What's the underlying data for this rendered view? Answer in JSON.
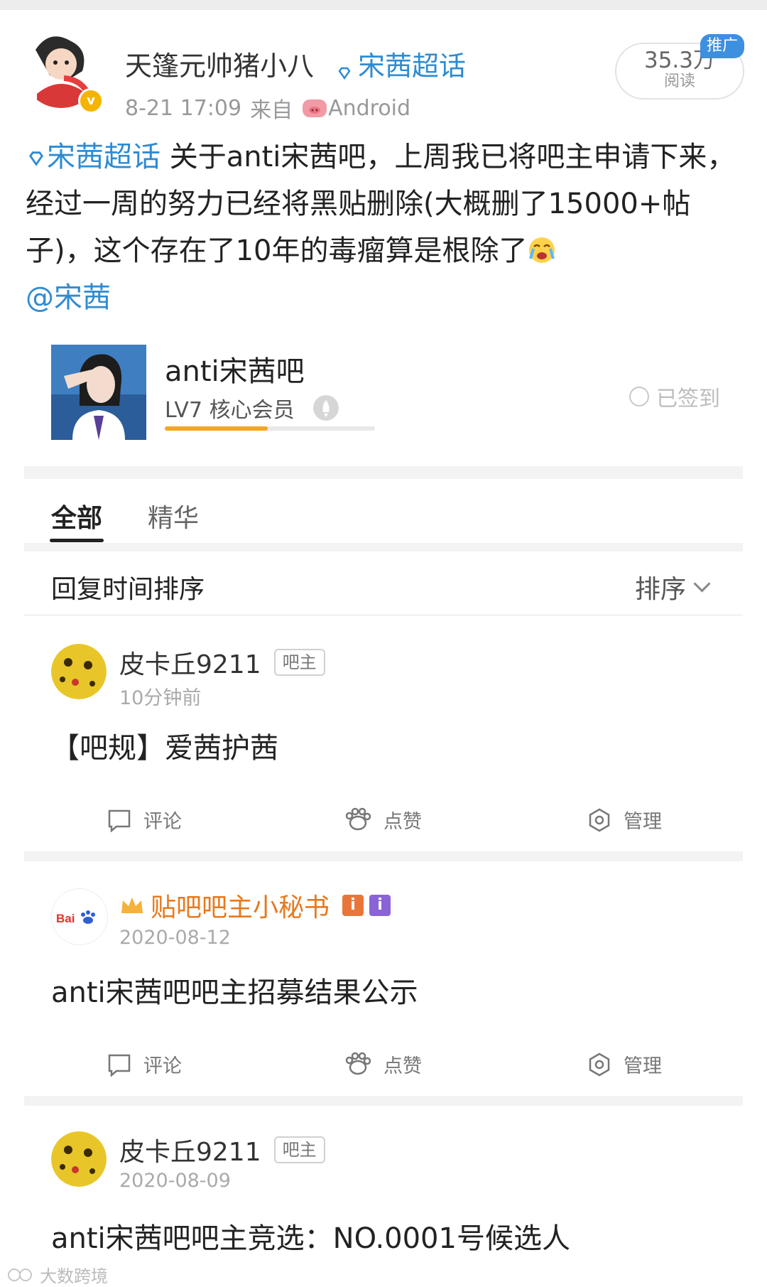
{
  "weibo": {
    "author_name": "天篷元帅猪小八",
    "super_topic": "宋茜超话",
    "time": "8-21 17:09",
    "source_prefix": "来自",
    "source_app": "Android",
    "reads_count": "35.3万",
    "reads_label": "阅读",
    "promo_badge": "推广",
    "verified_badge": "v",
    "body_tag": "宋茜超话",
    "body_text": " 关于anti宋茜吧，上周我已将吧主申请下来，经过一周的努力已经将黑贴删除(大概删了15000+帖子)，这个存在了10年的毒瘤算是根除了",
    "mention": "@宋茜"
  },
  "tieba": {
    "forum_name": "anti宋茜吧",
    "level": "LV7 核心会员",
    "level_progress": 0.49,
    "signed_status": "已签到",
    "tabs": [
      "全部",
      "精华"
    ],
    "sort_label": "回复时间排序",
    "sort_button": "排序"
  },
  "posts": [
    {
      "author": "皮卡丘9211",
      "badge": "吧主",
      "time": "10分钟前",
      "title": "【吧规】爱茜护茜",
      "actions": [
        "评论",
        "点赞",
        "管理"
      ]
    },
    {
      "author": "贴吧吧主小秘书",
      "badge_icons": [
        "i",
        "i"
      ],
      "time": "2020-08-12",
      "title": "anti宋茜吧吧主招募结果公示",
      "actions": [
        "评论",
        "点赞",
        "管理"
      ]
    },
    {
      "author": "皮卡丘9211",
      "badge": "吧主",
      "time": "2020-08-09",
      "title": "anti宋茜吧吧主竞选：NO.0001号候选人"
    }
  ],
  "watermark": "大数跨境",
  "colors": {
    "link_blue": "#2f8bd1",
    "progress_orange": "#f4a523",
    "secretary_orange": "#e7791e",
    "promo_blue": "#3d8fe0"
  }
}
